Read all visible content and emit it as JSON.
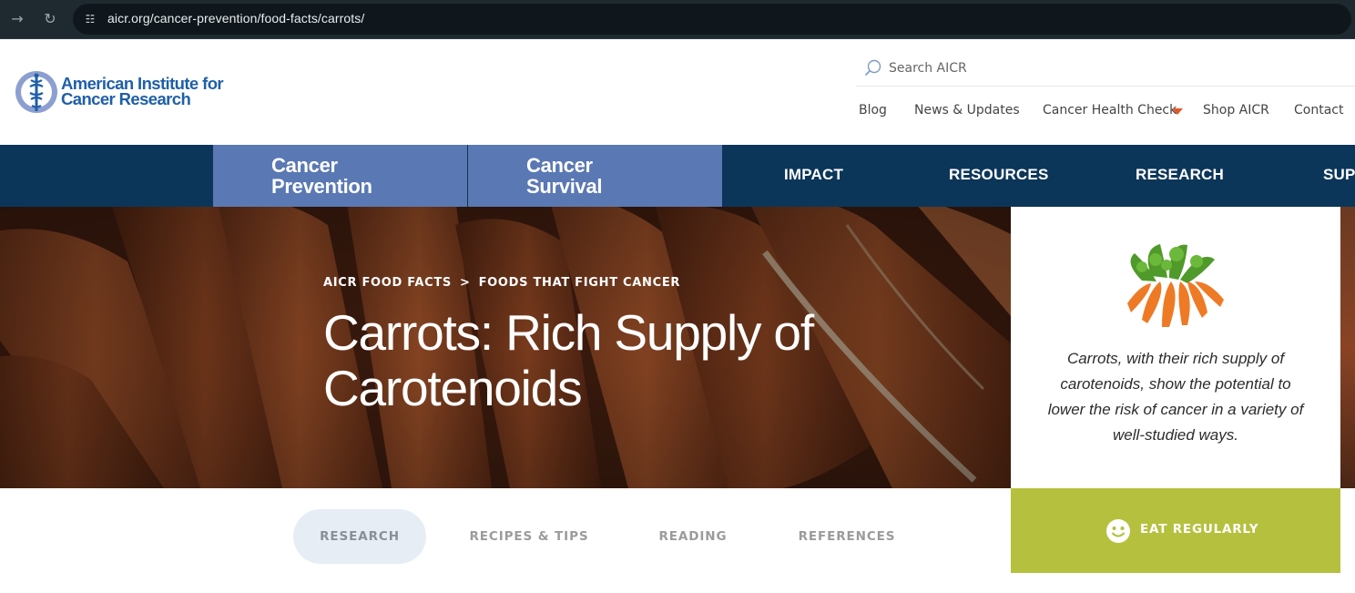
{
  "browser": {
    "url": "aicr.org/cancer-prevention/food-facts/carrots/",
    "forward_icon": "arrow-right-icon",
    "reload_icon": "reload-icon",
    "site_info_icon": "site-settings-icon"
  },
  "header": {
    "logo_line1": "American Institute for",
    "logo_line2": "Cancer Research",
    "search_placeholder": "Search AICR",
    "util_nav": [
      "Blog",
      "News & Updates",
      "Cancer Health Check",
      "Shop AICR",
      "Contact"
    ]
  },
  "main_nav": {
    "tabs": [
      {
        "line1": "Cancer",
        "line2": "Prevention"
      },
      {
        "line1": "Cancer",
        "line2": "Survival"
      }
    ],
    "links": [
      "IMPACT",
      "RESOURCES",
      "RESEARCH",
      "SUP"
    ]
  },
  "hero": {
    "breadcrumb": [
      "AICR FOOD FACTS",
      ">",
      "FOODS THAT FIGHT CANCER"
    ],
    "title": "Carrots: Rich Supply of Carotenoids"
  },
  "side_card": {
    "text": "Carrots, with their rich supply of carotenoids, show the potential to lower the risk of cancer in a variety of well-studied ways.",
    "cta": "EAT REGULARLY"
  },
  "sub_tabs": [
    "RESEARCH",
    "RECIPES & TIPS",
    "READING",
    "REFERENCES"
  ],
  "colors": {
    "nav_dark": "#0c3659",
    "tab_blue": "#5a78b4",
    "accent_green": "#b5c13e",
    "caret_orange": "#e0582a",
    "logo_blue": "#1f5fa8"
  }
}
